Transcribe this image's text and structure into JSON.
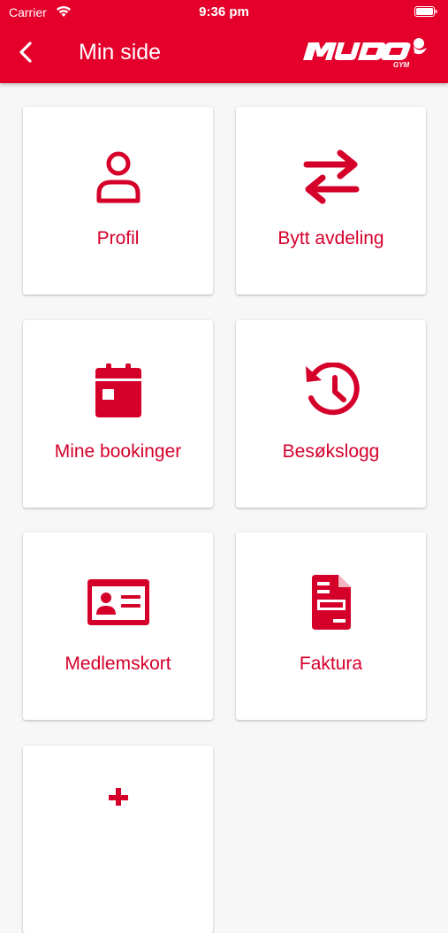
{
  "status_bar": {
    "carrier": "Carrier",
    "time": "9:36 pm"
  },
  "header": {
    "title": "Min side",
    "logo_text": "MUDO GYM",
    "brand_color": "#e4002b"
  },
  "menu": {
    "items": [
      {
        "label": "Profil",
        "icon": "person-icon"
      },
      {
        "label": "Bytt avdeling",
        "icon": "swap-arrows-icon"
      },
      {
        "label": "Mine bookinger",
        "icon": "calendar-icon"
      },
      {
        "label": "Besøkslogg",
        "icon": "history-icon"
      },
      {
        "label": "Medlemskort",
        "icon": "member-card-icon"
      },
      {
        "label": "Faktura",
        "icon": "invoice-icon"
      },
      {
        "label": "",
        "icon": "partial-icon"
      }
    ]
  }
}
